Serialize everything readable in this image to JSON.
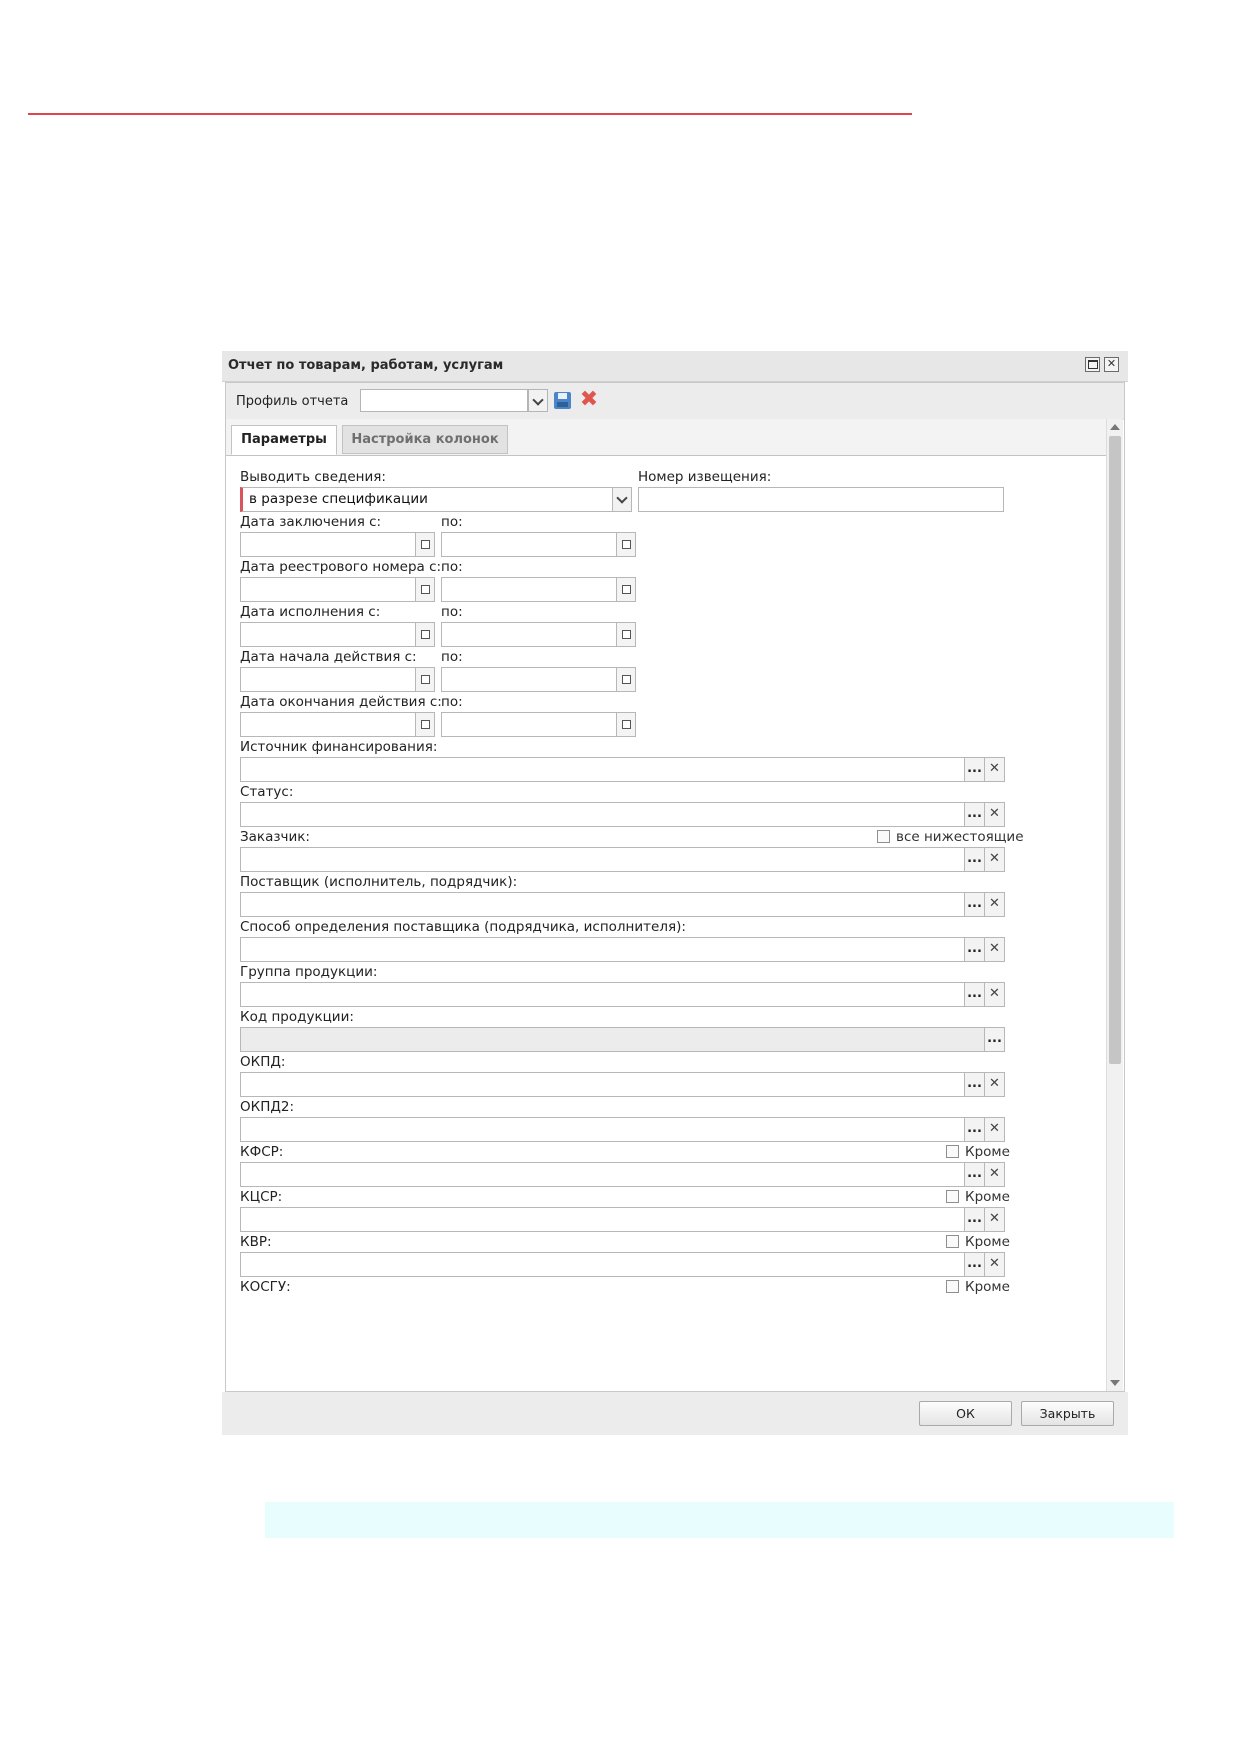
{
  "window": {
    "title": "Отчет по товарам, работам, услугам",
    "close_glyph": "✕"
  },
  "toolbar": {
    "profile_label": "Профиль отчета",
    "profile_value": "",
    "delete_glyph": "✖"
  },
  "tabs": [
    {
      "label": "Параметры",
      "active": true
    },
    {
      "label": "Настройка колонок",
      "active": false
    }
  ],
  "glyphs": {
    "lookup": "...",
    "clear": "✕"
  },
  "form": {
    "output_label": "Выводить сведения:",
    "output_value": "в разрезе спецификации",
    "notice_label": "Номер извещения:",
    "notice_value": "",
    "date_ranges": [
      {
        "from_label": "Дата заключения с:",
        "to_label": "по:"
      },
      {
        "from_label": "Дата реестрового номера с:",
        "to_label": "по:"
      },
      {
        "from_label": "Дата исполнения с:",
        "to_label": "по:"
      },
      {
        "from_label": "Дата начала действия с:",
        "to_label": "по:"
      },
      {
        "from_label": "Дата окончания действия с:",
        "to_label": "по:"
      }
    ],
    "funding_source_label": "Источник финансирования:",
    "status_label": "Статус:",
    "customer_label": "Заказчик:",
    "subordinates_label": "все нижестоящие",
    "supplier_label": "Поставщик (исполнитель, подрядчик):",
    "method_label": "Способ определения поставщика (подрядчика, исполнителя):",
    "product_group_label": "Группа продукции:",
    "product_code_label": "Код продукции:",
    "okpd_label": "ОКПД:",
    "okpd2_label": "ОКПД2:",
    "kfsr_label": "КФСР:",
    "kcsr_label": "КЦСР:",
    "kvr_label": "КВР:",
    "kosgu_label": "КОСГУ:",
    "except_label": "Кроме"
  },
  "buttons": {
    "ok": "ОК",
    "close": "Закрыть"
  },
  "colors": {
    "accent_line": "#e0454c",
    "required_marker": "#d9545b",
    "caption_bg": "#e8fdfd"
  }
}
